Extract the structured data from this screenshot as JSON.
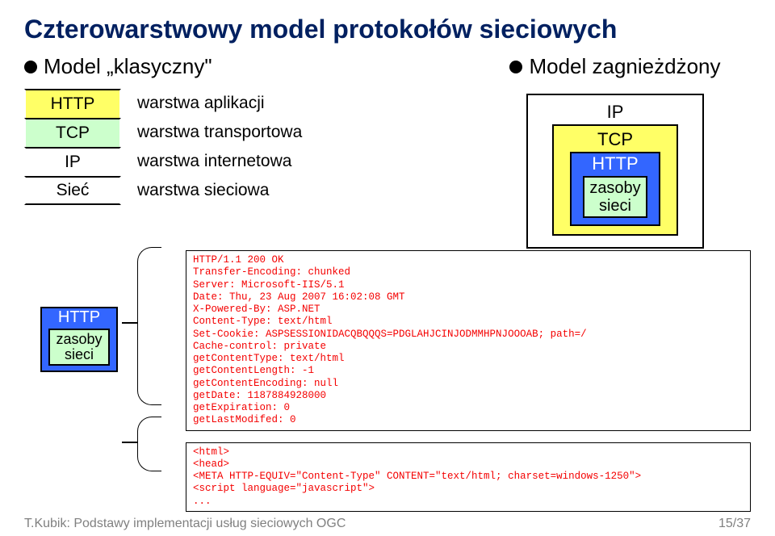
{
  "title": "Czterowarstwowy model protokołów sieciowych",
  "left_bullet": "Model „klasyczny\"",
  "right_bullet": "Model zagnieżdżony",
  "classic_layers": {
    "l1": "HTTP",
    "l2": "TCP",
    "l3": "IP",
    "l4": "Sieć"
  },
  "classic_desc": {
    "d1": "warstwa aplikacji",
    "d2": "warstwa transportowa",
    "d3": "warstwa internetowa",
    "d4": "warstwa sieciowa"
  },
  "nested": {
    "ip": "IP",
    "tcp": "TCP",
    "http": "HTTP",
    "zasoby_l1": "zasoby",
    "zasoby_l2": "sieci"
  },
  "mini": {
    "http": "HTTP",
    "zasoby_l1": "zasoby",
    "zasoby_l2": "sieci"
  },
  "code1": "HTTP/1.1 200 OK\nTransfer-Encoding: chunked\nServer: Microsoft-IIS/5.1\nDate: Thu, 23 Aug 2007 16:02:08 GMT\nX-Powered-By: ASP.NET\nContent-Type: text/html\nSet-Cookie: ASPSESSIONIDACQBQQQS=PDGLAHJCINJODMMHPNJOOOAB; path=/\nCache-control: private\ngetContentType: text/html\ngetContentLength: -1\ngetContentEncoding: null\ngetDate: 1187884928000\ngetExpiration: 0\ngetLastModifed: 0",
  "code2": "<html>\n<head>\n<META HTTP-EQUIV=\"Content-Type\" CONTENT=\"text/html; charset=windows-1250\">\n<script language=\"javascript\">\n...",
  "footer_left": "T.Kubik: Podstawy implementacji usług sieciowych OGC",
  "footer_right": "15/37"
}
